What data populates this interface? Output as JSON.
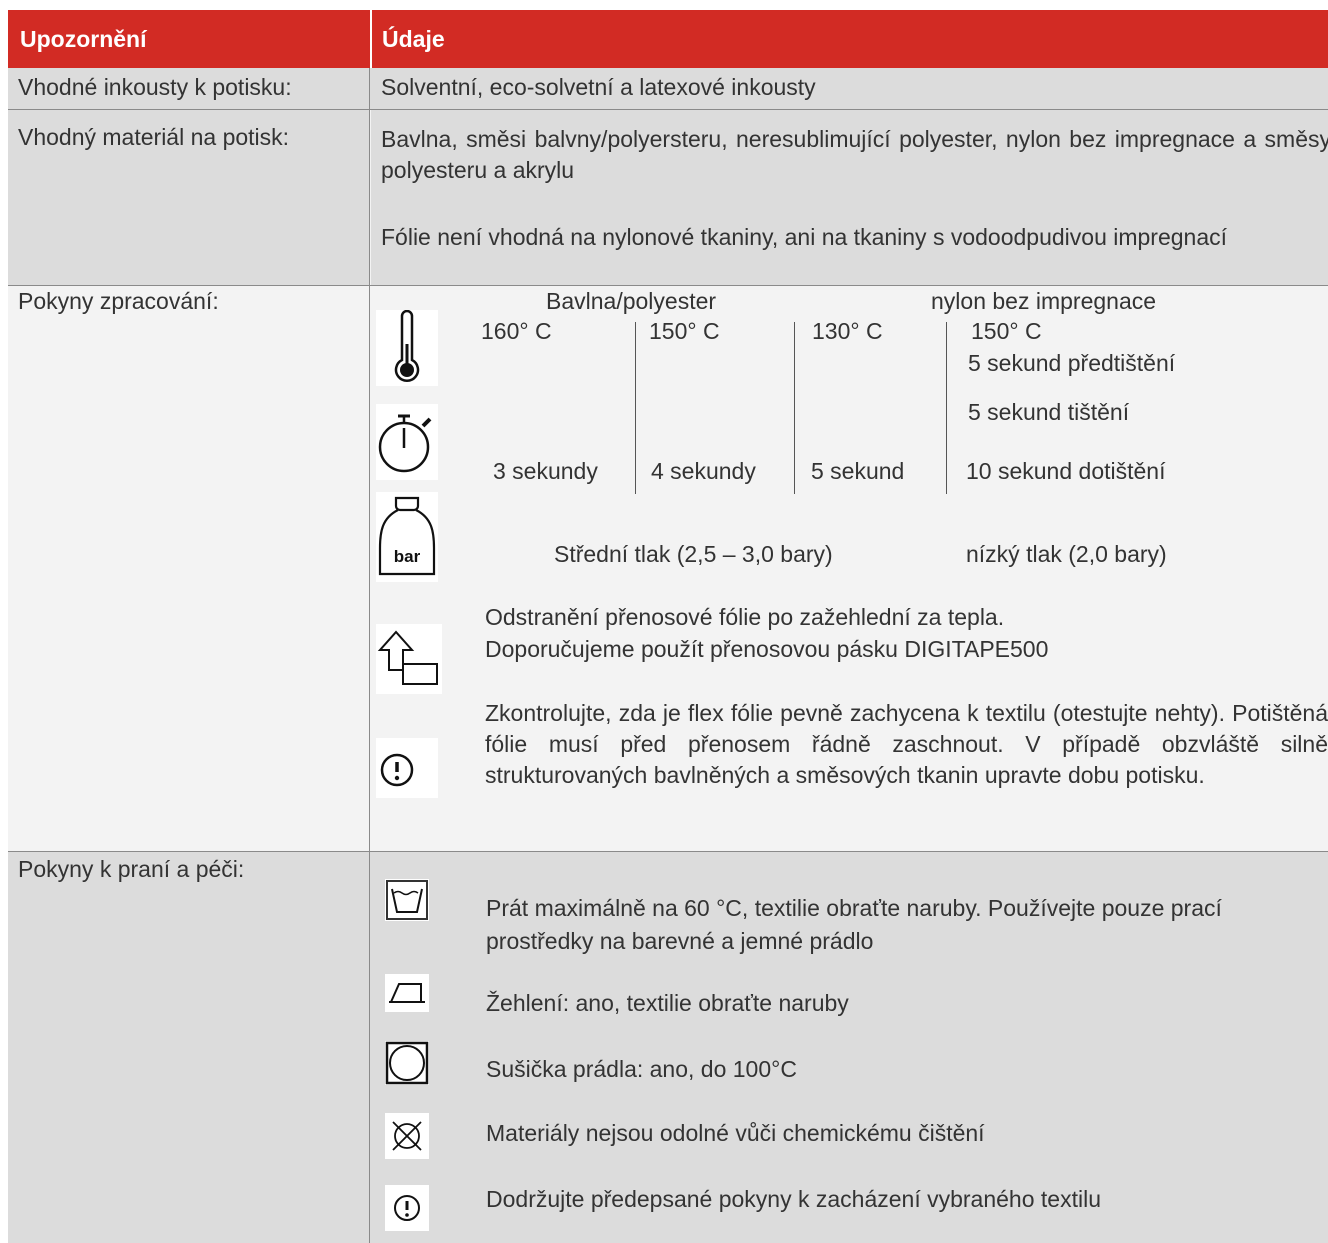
{
  "header": {
    "col1": "Upozornění",
    "col2": "Údaje"
  },
  "rows": {
    "inks": {
      "label": "Vhodné inkousty k potisku:",
      "value": "Solventní, eco-solvetní a latexové inkousty"
    },
    "material": {
      "label": "Vhodný materiál na potisk:",
      "para1": "Bavlna, směsi balvny/polyersteru, neresublimující polyester, nylon bez impregnace a směsy polyesteru a akrylu",
      "para2": "Fólie není vhodná na nylonové tkaniny, ani na tkaniny s vodoodpudivou impregnací"
    },
    "processing": {
      "label": "Pokyny zpracování:",
      "group_cotton": "Bavlna/polyester",
      "group_nylon": "nylon bez impregnace",
      "temps": [
        "160° C",
        "150° C",
        "130° C",
        "150° C"
      ],
      "times": [
        "3 sekundy",
        "4 sekundy",
        "5 sekund"
      ],
      "nylon_pre": "5 sekund předtištění",
      "nylon_print": "5 sekund tištění",
      "nylon_post": "10 sekund dotištění",
      "weight_label": "bar",
      "pressure_medium": "Střední tlak (2,5 – 3,0 bary)",
      "pressure_low": "nízký tlak (2,0 bary)",
      "peel_line1": "Odstranění přenosové fólie po zažehlední za tepla.",
      "peel_line2": "Doporučujeme použít přenosovou pásku DIGITAPE500",
      "check_text": "Zkontrolujte, zda je flex fólie pevně zachycena k textilu (otestujte nehty). Potištěná fólie musí před přenosem řádně zaschnout. V případě obzvláště silně strukturovaných bavlněných a směsových tkanin upravte dobu potisku."
    },
    "care": {
      "label": "Pokyny k praní a péči:",
      "wash": "Prát maximálně na 60 °C, textilie obraťte naruby. Používejte pouze prací prostředky na barevné a jemné prádlo",
      "iron": "Žehlení: ano, textilie obraťte naruby",
      "dryer": "Sušička prádla: ano, do 100°C",
      "dryclean": "Materiály nejsou odolné vůči chemickému čištění",
      "follow": "Dodržujte předepsané pokyny k zacházení vybraného textilu"
    }
  },
  "icons": [
    "thermometer-icon",
    "stopwatch-icon",
    "weight-icon",
    "peel-arrow-icon",
    "warning-icon",
    "wash-tub-icon",
    "iron-icon",
    "tumble-dry-icon",
    "no-dry-clean-icon",
    "warning-icon"
  ],
  "colors": {
    "header_bg": "#d22b24",
    "header_text": "#ffffff",
    "row_gray": "#dcdcdc",
    "row_light": "#f3f3f3"
  }
}
